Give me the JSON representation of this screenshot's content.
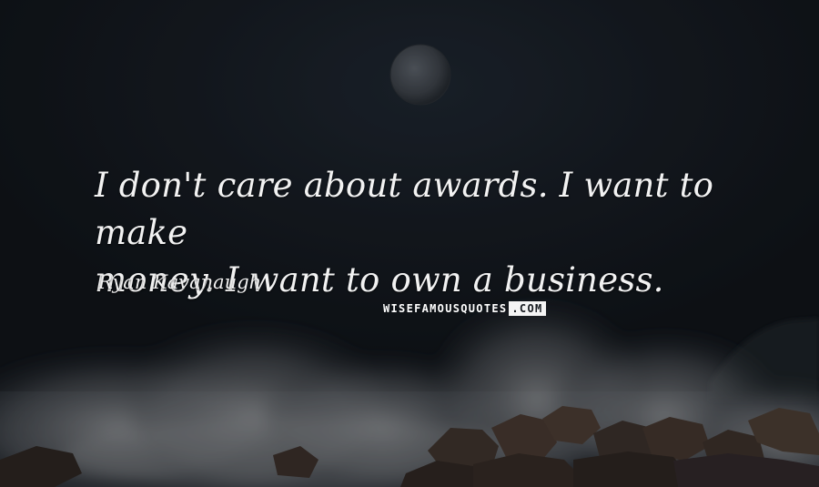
{
  "quote": {
    "line1": "I don't care about awards. I want to make",
    "line2": "money. I want to own a business."
  },
  "author": {
    "name": "Ryan Kavanaugh"
  },
  "watermark": {
    "part1": "WISEFAMOUSQUOTES",
    "part2": ".COM"
  },
  "colors": {
    "sky": "#161b22",
    "text": "#f2f2f2",
    "spray": "#8d9096",
    "rocks": "#3a2f2a"
  }
}
